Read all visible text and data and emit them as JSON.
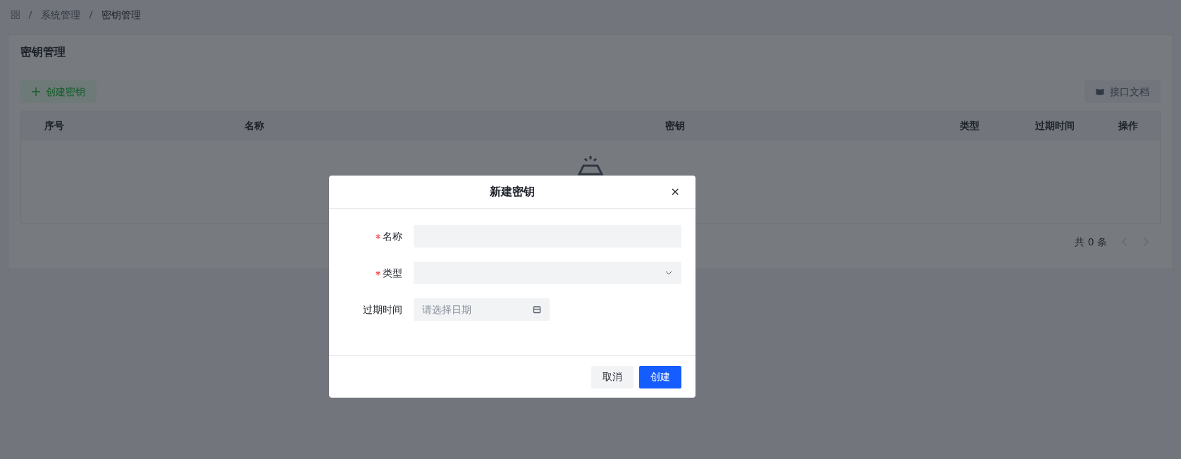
{
  "breadcrumb": [
    "系统管理",
    "密钥管理"
  ],
  "card": {
    "title": "密钥管理",
    "create_button": "创建密钥",
    "docs_button": "接口文档"
  },
  "table": {
    "columns": [
      "序号",
      "名称",
      "密钥",
      "类型",
      "过期时间",
      "操作"
    ]
  },
  "pagination": {
    "total": "共 0 条",
    "prev_disabled": true,
    "next_disabled": true
  },
  "dialog": {
    "title": "新建密钥",
    "close": "×",
    "fields": [
      {
        "kind": "text",
        "label": "名称",
        "required": true
      },
      {
        "kind": "select",
        "label": "类型",
        "required": true
      },
      {
        "kind": "date",
        "label": "过期时间",
        "required": false,
        "placeholder": "请选择日期"
      }
    ],
    "buttons": [
      {
        "kind": "secondary",
        "label": "取消"
      },
      {
        "kind": "primary",
        "label": "创建"
      }
    ]
  }
}
